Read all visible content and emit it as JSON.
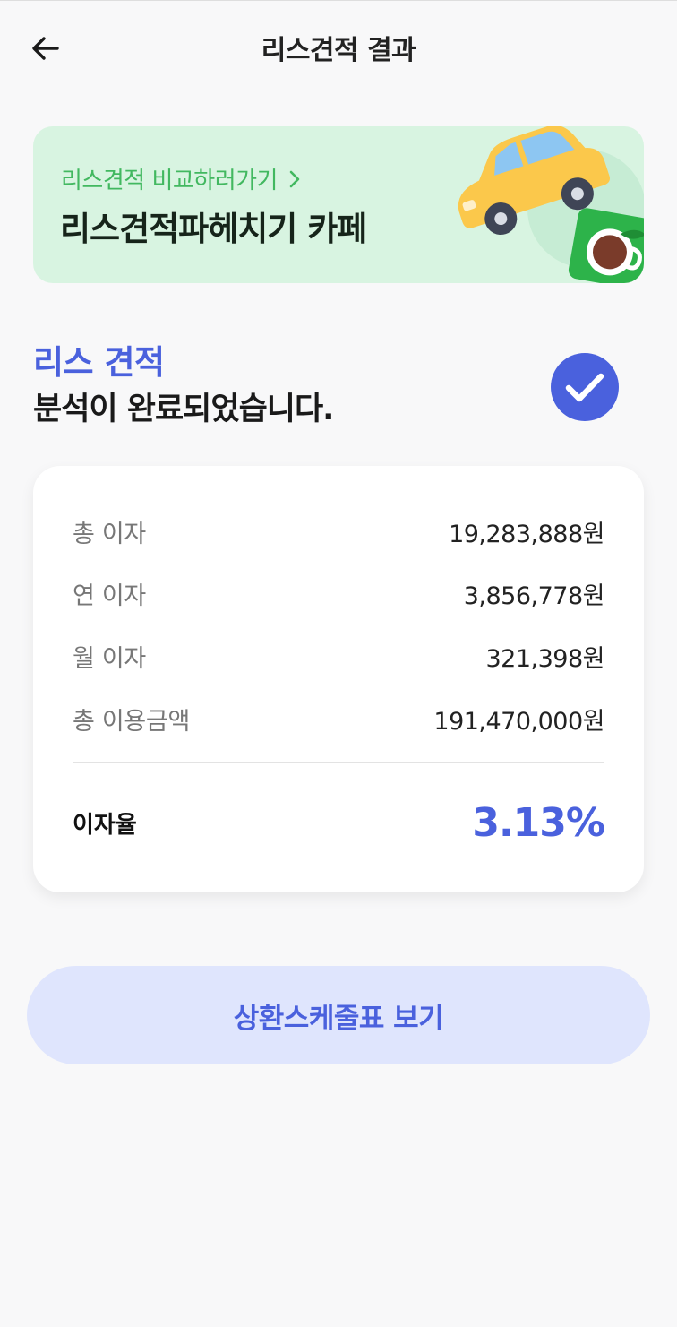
{
  "header": {
    "title": "리스견적 결과",
    "back_icon": "arrow-left-icon"
  },
  "banner": {
    "link_label": "리스견적 비교하러가기",
    "link_icon": "chevron-right-icon",
    "title": "리스견적파헤치기 카페",
    "bg_color": "#d8f4e1",
    "link_color": "#42b860",
    "art_icons": [
      "car-icon",
      "coffee-cup-icon"
    ]
  },
  "result": {
    "accent": "리스 견적",
    "message": "분석이 완료되었습니다.",
    "status_icon": "check-circle-icon",
    "accent_color": "#4a61dd"
  },
  "summary": {
    "rows": [
      {
        "label": "총 이자",
        "value": "19,283,888원"
      },
      {
        "label": "연 이자",
        "value": "3,856,778원"
      },
      {
        "label": "월 이자",
        "value": "321,398원"
      },
      {
        "label": "총 이용금액",
        "value": "191,470,000원"
      }
    ],
    "rate_label": "이자율",
    "rate_value": "3.13%"
  },
  "actions": {
    "schedule_label": "상환스케줄표 보기"
  }
}
